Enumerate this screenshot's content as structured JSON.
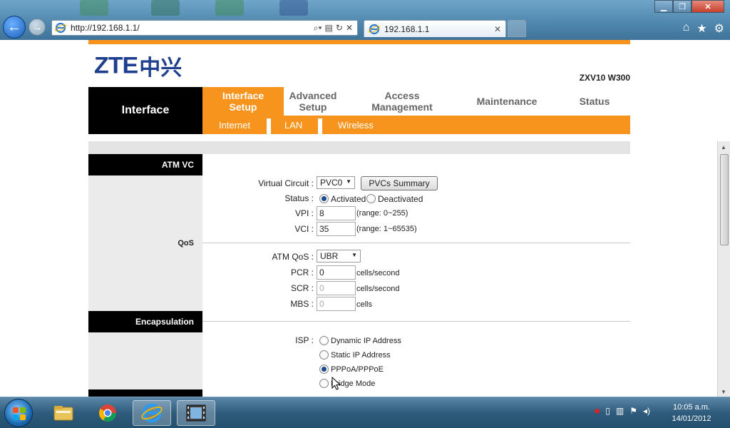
{
  "browser": {
    "address": "http://192.168.1.1/",
    "tab_title": "192.168.1.1",
    "close_glyph": "✕",
    "icons": [
      "ie-icon",
      "search-icon",
      "refresh-icon",
      "home-icon",
      "favorites-icon",
      "tools-icon"
    ]
  },
  "header": {
    "brand": "ZTE",
    "brand_cn": "中兴",
    "model": "ZXV10 W300"
  },
  "nav": {
    "section": "Interface",
    "tabs": [
      {
        "label": "Interface\nSetup",
        "active": true
      },
      {
        "label": "Advanced\nSetup",
        "active": false
      },
      {
        "label": "Access\nManagement",
        "active": false
      },
      {
        "label": "Maintenance",
        "active": false
      },
      {
        "label": "Status",
        "active": false
      }
    ],
    "subtabs": [
      "Internet",
      "LAN",
      "Wireless"
    ]
  },
  "sections": {
    "atm_vc": "ATM VC",
    "qos": "QoS",
    "encapsulation": "Encapsulation"
  },
  "form": {
    "virtual_circuit_label": "Virtual Circuit :",
    "virtual_circuit_value": "PVC0",
    "pvcs_summary_label": "PVCs Summary",
    "status_label": "Status :",
    "status_activated": "Activated",
    "status_deactivated": "Deactivated",
    "vpi_label": "VPI :",
    "vpi_value": "8",
    "vpi_range": "(range: 0~255)",
    "vci_label": "VCI :",
    "vci_value": "35",
    "vci_range": "(range: 1~65535)",
    "atm_qos_label": "ATM QoS :",
    "atm_qos_value": "UBR",
    "pcr_label": "PCR :",
    "pcr_value": "0",
    "scr_label": "SCR :",
    "scr_value": "0",
    "mbs_label": "MBS :",
    "mbs_value": "0",
    "cells_per_second": "cells/second",
    "cells": "cells",
    "isp_label": "ISP :",
    "isp_options": [
      "Dynamic IP Address",
      "Static IP Address",
      "PPPoA/PPPoE",
      "Bridge Mode"
    ],
    "isp_selected": "PPPoA/PPPoE"
  },
  "taskbar": {
    "time": "10:05 a.m.",
    "date": "14/01/2012"
  },
  "colors": {
    "accent": "#f7941e",
    "brand": "#1e3f8f"
  }
}
